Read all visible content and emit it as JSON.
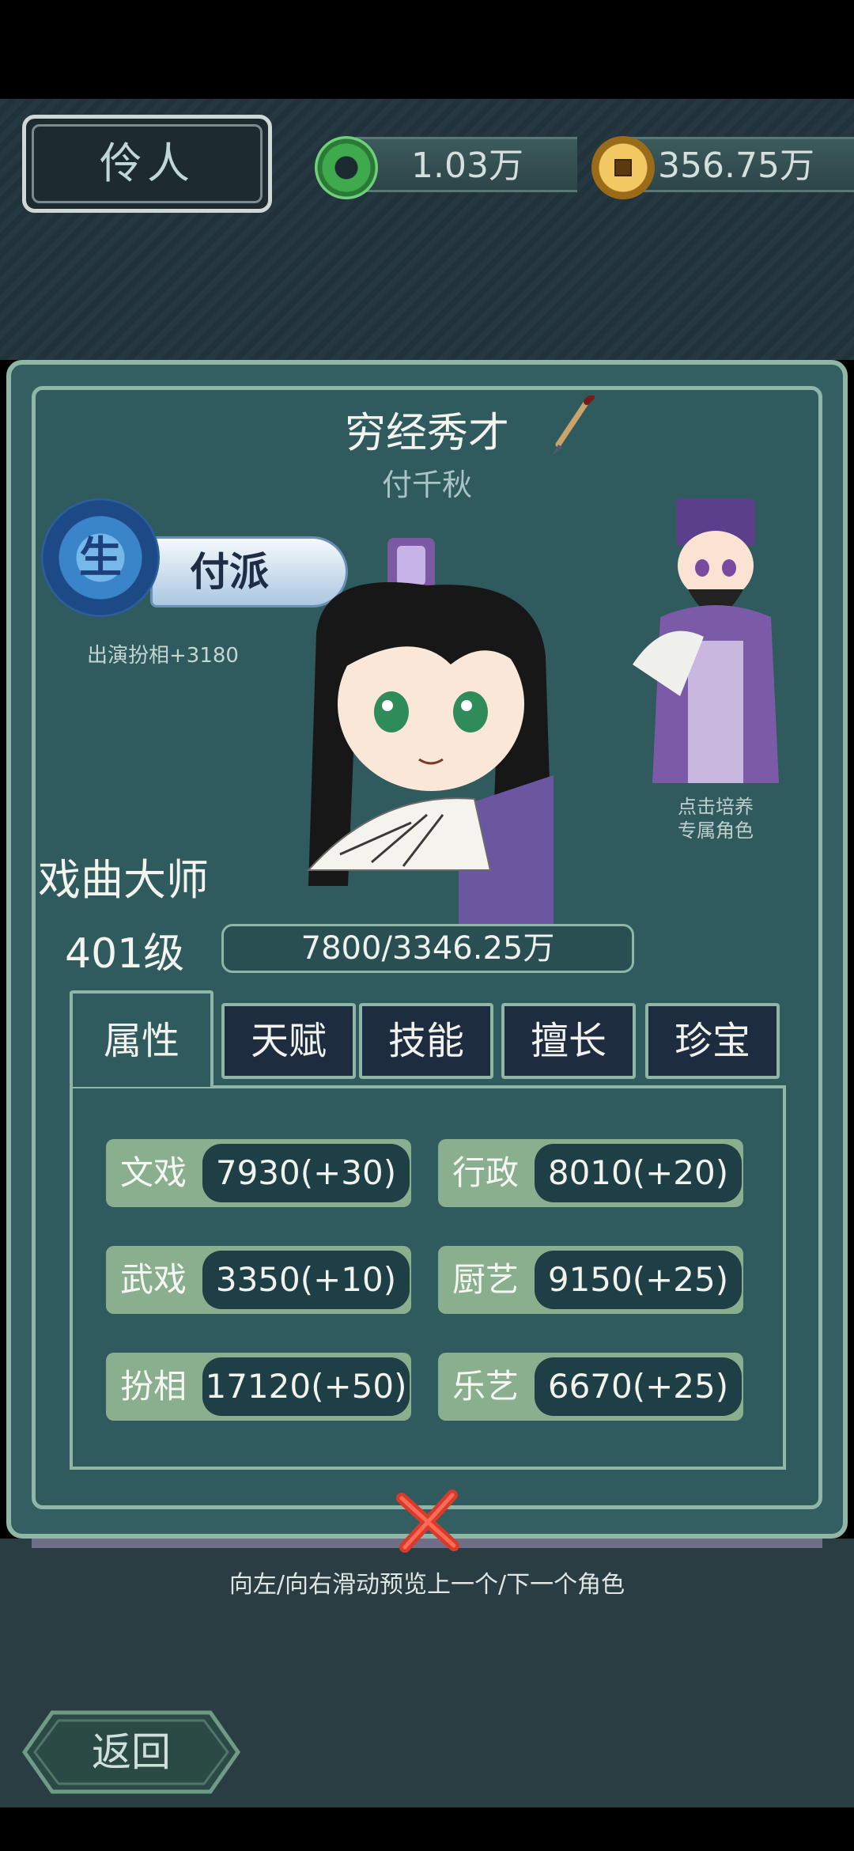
{
  "header": {
    "title": "伶人",
    "jade_amount": "1.03万",
    "coin_amount": "356.75万"
  },
  "role": {
    "title": "穷经秀才",
    "name": "付千秋",
    "school_char": "生",
    "school": "付派",
    "school_bonus": "出演扮相+3180",
    "rank": "戏曲大师",
    "level": "401级",
    "exp": "7800/3346.25万",
    "train_hint_line1": "点击培养",
    "train_hint_line2": "专属角色"
  },
  "tabs": [
    "属性",
    "天赋",
    "技能",
    "擅长",
    "珍宝"
  ],
  "stats": [
    {
      "label": "文戏",
      "value": "7930(+30)"
    },
    {
      "label": "行政",
      "value": "8010(+20)"
    },
    {
      "label": "武戏",
      "value": "3350(+10)"
    },
    {
      "label": "厨艺",
      "value": "9150(+25)"
    },
    {
      "label": "扮相",
      "value": "17120(+50)"
    },
    {
      "label": "乐艺",
      "value": "6670(+25)"
    }
  ],
  "swipe_hint": "向左/向右滑动预览上一个/下一个角色",
  "back_label": "返回",
  "colors": {
    "panel": "#2f5a5e",
    "border": "#8fb6a6",
    "stat_bg": "#8aaf8e",
    "stat_value_bg": "#1e3f45",
    "close_red": "#d83a2c"
  },
  "icons": [
    "jade-icon",
    "coin-icon",
    "brush-icon",
    "dragon-badge-icon",
    "close-icon",
    "back-icon"
  ]
}
